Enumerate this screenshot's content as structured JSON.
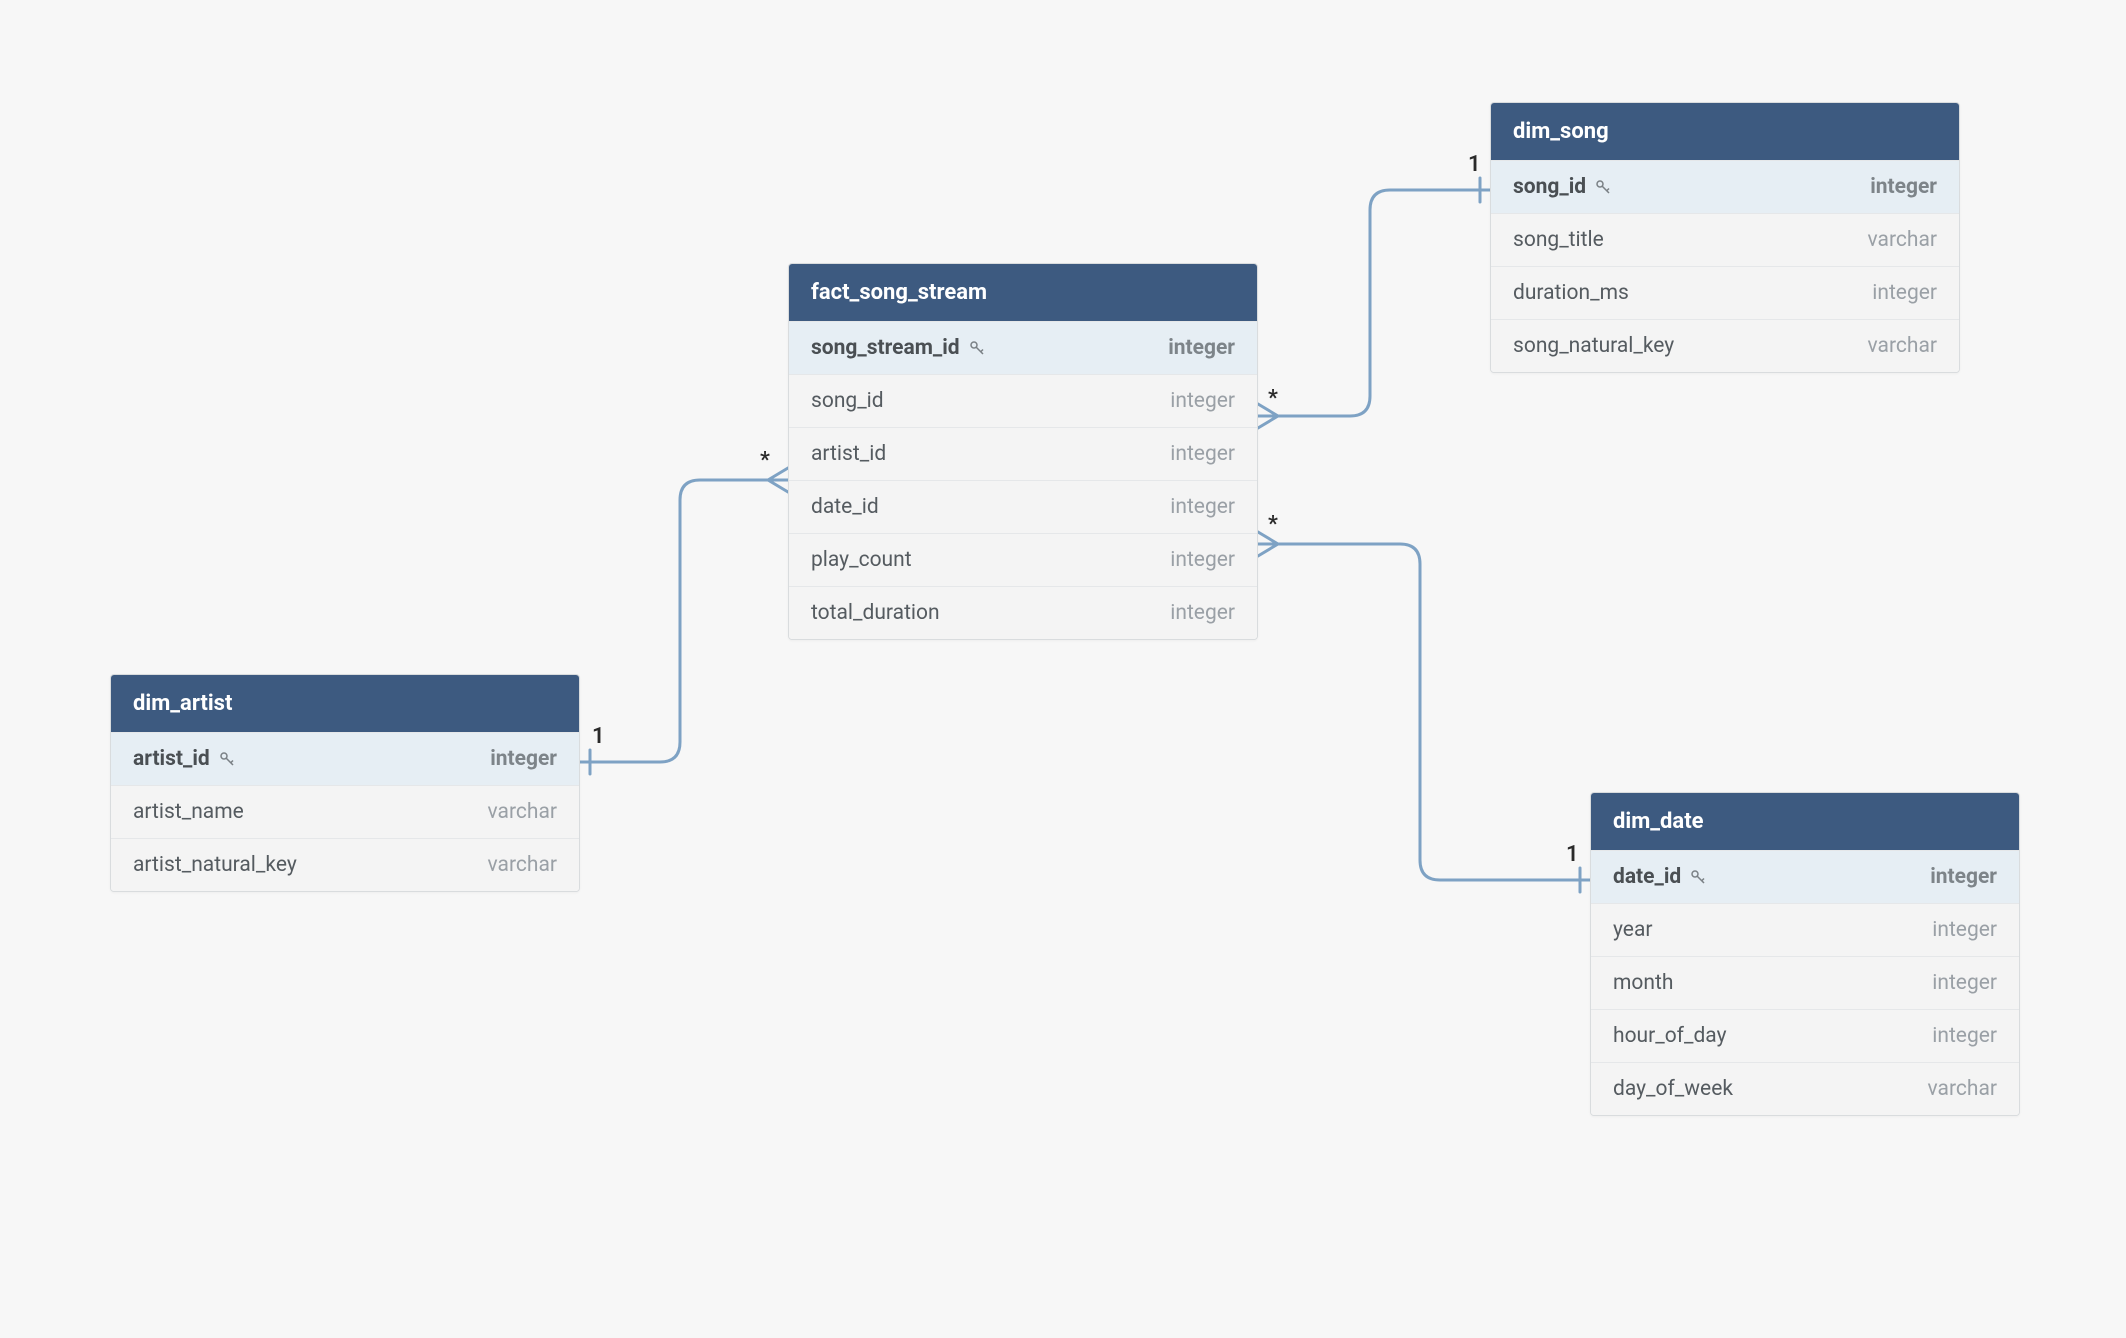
{
  "tables": {
    "fact_song_stream": {
      "title": "fact_song_stream",
      "columns": [
        {
          "name": "song_stream_id",
          "type": "integer",
          "pk": true
        },
        {
          "name": "song_id",
          "type": "integer",
          "pk": false
        },
        {
          "name": "artist_id",
          "type": "integer",
          "pk": false
        },
        {
          "name": "date_id",
          "type": "integer",
          "pk": false
        },
        {
          "name": "play_count",
          "type": "integer",
          "pk": false
        },
        {
          "name": "total_duration",
          "type": "integer",
          "pk": false
        }
      ]
    },
    "dim_song": {
      "title": "dim_song",
      "columns": [
        {
          "name": "song_id",
          "type": "integer",
          "pk": true
        },
        {
          "name": "song_title",
          "type": "varchar",
          "pk": false
        },
        {
          "name": "duration_ms",
          "type": "integer",
          "pk": false
        },
        {
          "name": "song_natural_key",
          "type": "varchar",
          "pk": false
        }
      ]
    },
    "dim_artist": {
      "title": "dim_artist",
      "columns": [
        {
          "name": "artist_id",
          "type": "integer",
          "pk": true
        },
        {
          "name": "artist_name",
          "type": "varchar",
          "pk": false
        },
        {
          "name": "artist_natural_key",
          "type": "varchar",
          "pk": false
        }
      ]
    },
    "dim_date": {
      "title": "dim_date",
      "columns": [
        {
          "name": "date_id",
          "type": "integer",
          "pk": true
        },
        {
          "name": "year",
          "type": "integer",
          "pk": false
        },
        {
          "name": "month",
          "type": "integer",
          "pk": false
        },
        {
          "name": "hour_of_day",
          "type": "integer",
          "pk": false
        },
        {
          "name": "day_of_week",
          "type": "varchar",
          "pk": false
        }
      ]
    }
  },
  "relations": [
    {
      "from": "fact_song_stream.song_id",
      "to": "dim_song.song_id",
      "from_card": "*",
      "to_card": "1"
    },
    {
      "from": "fact_song_stream.artist_id",
      "to": "dim_artist.artist_id",
      "from_card": "*",
      "to_card": "1"
    },
    {
      "from": "fact_song_stream.date_id",
      "to": "dim_date.date_id",
      "from_card": "*",
      "to_card": "1"
    }
  ],
  "cardinality_labels": {
    "song_many": "*",
    "song_one": "1",
    "artist_many": "*",
    "artist_one": "1",
    "date_many": "*",
    "date_one": "1"
  }
}
